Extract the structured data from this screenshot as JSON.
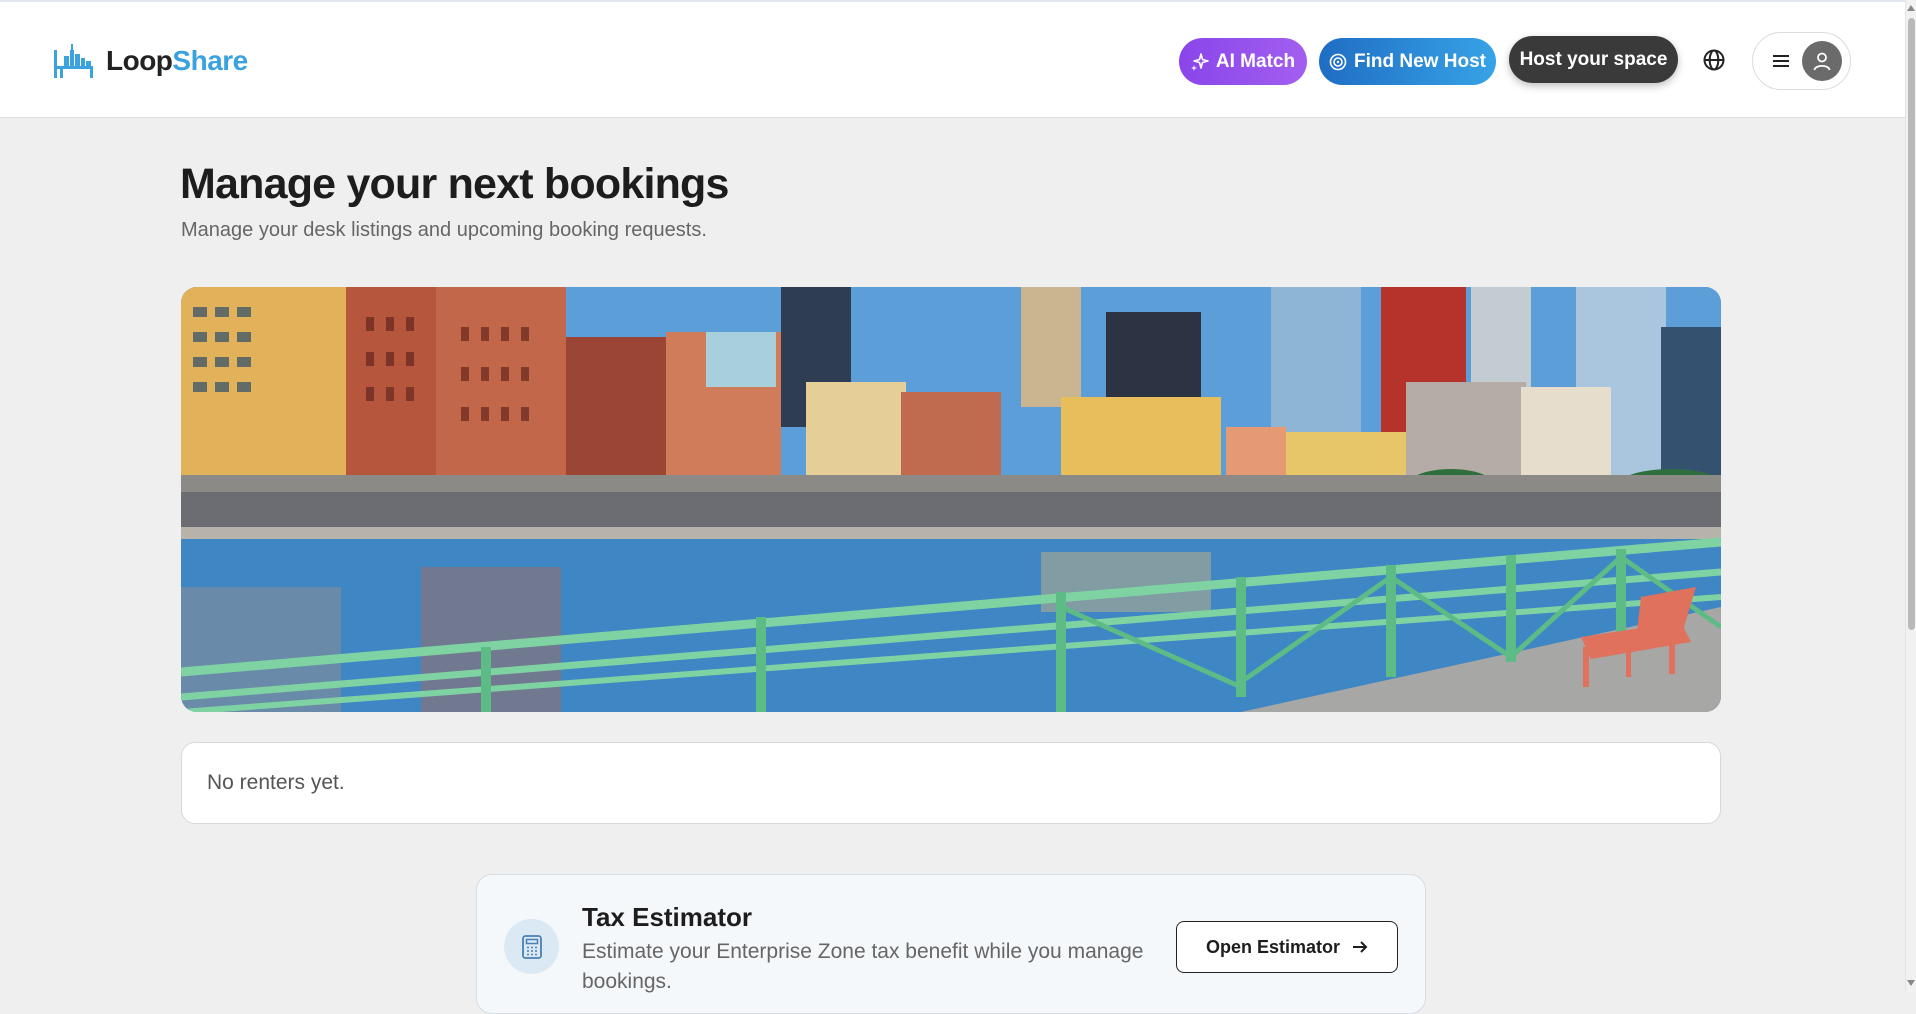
{
  "header": {
    "logo_part1": "Loop",
    "logo_part2": "Share",
    "ai_match_label": "AI Match",
    "find_host_label": "Find New Host",
    "host_space_label": "Host your space"
  },
  "page": {
    "title": "Manage your next bookings",
    "subtitle": "Manage your desk listings and upcoming booking requests."
  },
  "renters": {
    "empty_text": "No renters yet."
  },
  "tax_card": {
    "title": "Tax Estimator",
    "description": "Estimate your Enterprise Zone tax benefit while you manage bookings.",
    "button_label": "Open Estimator"
  },
  "icons": {
    "logo": "desk-skyline-logo-icon",
    "ai_match": "sparkles-icon",
    "find_host": "target-icon",
    "language": "globe-icon",
    "menu": "hamburger-menu-icon",
    "user": "user-avatar-icon",
    "tax": "calculator-icon",
    "open": "arrow-right-icon"
  },
  "colors": {
    "brand_blue": "#3aa3df",
    "ai_purple": "#8a45ea",
    "find_blue": "#1f6dc4",
    "host_dark": "#3a3a3a"
  }
}
